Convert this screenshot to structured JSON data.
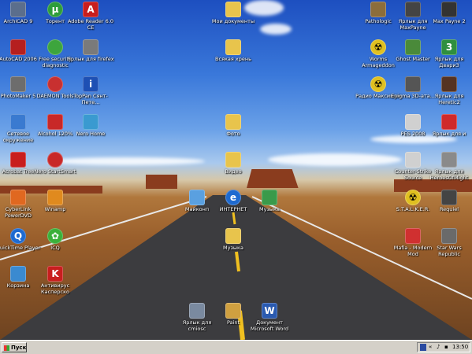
{
  "desktop": {
    "icons": [
      {
        "label": "ArchiCAD 9",
        "color": "#5b6e8c",
        "icon": "archicad-icon"
      },
      {
        "label": "Торент",
        "color": "#2e9d3a",
        "icon": "utorrent-icon"
      },
      {
        "label": "Adobe Reader 6.0 CE",
        "color": "#c81e1e",
        "icon": "adobe-reader-icon"
      },
      {
        "label": "Мои документы",
        "color": "#e8c44c",
        "icon": "folder-icon"
      },
      {
        "label": "Pathologic",
        "color": "#8c6d3a",
        "icon": "pathologic-icon"
      },
      {
        "label": "Ярлык для MaxPayne",
        "color": "#444444",
        "icon": "maxpayne-icon"
      },
      {
        "label": "Max Payne 2",
        "color": "#333333",
        "icon": "maxpayne2-icon"
      },
      {
        "label": "AutoCAD 2006",
        "color": "#b51f1f",
        "icon": "autocad-icon"
      },
      {
        "label": "Free security diagnostic",
        "color": "#3da53d",
        "icon": "security-icon"
      },
      {
        "label": "Ярлык для firefex",
        "color": "#7a7a7a",
        "icon": "keyboard-icon"
      },
      {
        "label": "Всякая хрень",
        "color": "#e8c44c",
        "icon": "folder-icon"
      },
      {
        "label": "Worms Armageddon",
        "color": "#e0c020",
        "icon": "radiation-icon"
      },
      {
        "label": "Ghost Master",
        "color": "#4a8a3a",
        "icon": "ghost-master-icon"
      },
      {
        "label": "Ярлык для Двари3",
        "color": "#2f8f3f",
        "icon": "heretic-icon"
      },
      {
        "label": "PhotoMaker 5",
        "color": "#6d6d6d",
        "icon": "photomaker-icon"
      },
      {
        "label": "DAEMON Tools",
        "color": "#c83030",
        "icon": "daemon-tools-icon"
      },
      {
        "label": "TopPan Сянт-Пете...",
        "color": "#1e50b4",
        "icon": "info-icon"
      },
      {
        "label": "Радио Максимум",
        "color": "#e0c020",
        "icon": "radiation-icon"
      },
      {
        "label": "Enigma 3D-ата...",
        "color": "#555555",
        "icon": "enigma-icon"
      },
      {
        "label": "Ярлык для Heretic2",
        "color": "#553322",
        "icon": "heretic2-icon"
      },
      {
        "label": "Сетевое окружение",
        "color": "#3a7ad0",
        "icon": "network-icon"
      },
      {
        "label": "Alcohol 120%",
        "color": "#c82828",
        "icon": "alcohol-icon"
      },
      {
        "label": "Nero Home",
        "color": "#3a9ad0",
        "icon": "nero-home-icon"
      },
      {
        "label": "Фото",
        "color": "#e8c44c",
        "icon": "folder-icon"
      },
      {
        "label": "PES 2008",
        "color": "#d0d0d0",
        "icon": "pes-icon"
      },
      {
        "label": "Ярлык для и",
        "color": "#d02a2a",
        "icon": "shortcut-icon"
      },
      {
        "label": "Acrobat Tree",
        "color": "#c81e1e",
        "icon": "acrobat-icon"
      },
      {
        "label": "Nero StartSmart",
        "color": "#c82828",
        "icon": "nero-icon"
      },
      {
        "label": "Видео",
        "color": "#e8c44c",
        "icon": "folder-icon"
      },
      {
        "label": "Counter-Strike Source",
        "color": "#d0d0d0",
        "icon": "counter-strike-icon"
      },
      {
        "label": "Ярлык для HeroesOfMight",
        "color": "#8a8a8a",
        "icon": "heroes-icon"
      },
      {
        "label": "CyberLink PowerDVD",
        "color": "#e06820",
        "icon": "powerdvd-icon"
      },
      {
        "label": "Winamp",
        "color": "#e08a1e",
        "icon": "winamp-icon"
      },
      {
        "label": "Майконп",
        "color": "#5aa0e0",
        "icon": "my-computer-icon"
      },
      {
        "label": "ИНТЕРНЕТ",
        "color": "#1e6ad0",
        "icon": "internet-explorer-icon"
      },
      {
        "label": "Музыка",
        "color": "#3a9a4a",
        "icon": "music-icon"
      },
      {
        "label": "S.T.A.L.K.E.R.",
        "color": "#e0c020",
        "icon": "radiation-icon"
      },
      {
        "label": "Requiel",
        "color": "#444444",
        "icon": "requiem-icon"
      },
      {
        "label": "QuickTime Player",
        "color": "#1e6ad0",
        "icon": "quicktime-icon"
      },
      {
        "label": "ICQ",
        "color": "#3ab03a",
        "icon": "icq-icon"
      },
      {
        "label": "Музыка",
        "color": "#e8c44c",
        "icon": "folder-icon"
      },
      {
        "label": "Mafia - Modern Mod",
        "color": "#d03030",
        "icon": "mafia-icon"
      },
      {
        "label": "Star Wars Republic",
        "color": "#6a6a6a",
        "icon": "star-wars-icon"
      },
      {
        "label": "Корзина",
        "color": "#3a8ad0",
        "icon": "recycle-bin-icon"
      },
      {
        "label": "Антивирус Касперско",
        "color": "#c81e1e",
        "icon": "kaspersky-icon"
      },
      {
        "label": "Ярлык для cmiosc",
        "color": "#7a8aa0",
        "icon": "shortcut-icon"
      },
      {
        "label": "Paint",
        "color": "#d0a040",
        "icon": "paint-icon"
      },
      {
        "label": "Документ Microsoft Word",
        "color": "#2a5ab0",
        "icon": "word-document-icon"
      }
    ]
  },
  "taskbar": {
    "start_label": "Пуск",
    "tray_lang": "«",
    "clock": "13:50"
  }
}
